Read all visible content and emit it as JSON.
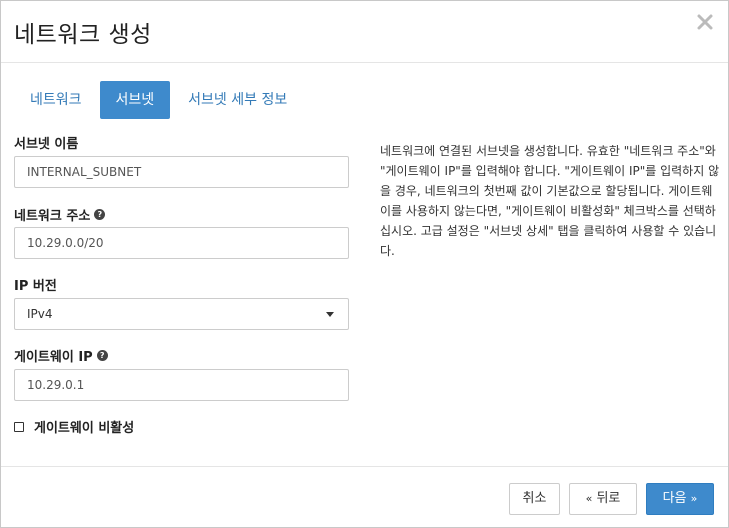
{
  "modal": {
    "title": "네트워크 생성"
  },
  "tabs": [
    {
      "label": "네트워크",
      "active": false
    },
    {
      "label": "서브넷",
      "active": true
    },
    {
      "label": "서브넷 세부 정보",
      "active": false
    }
  ],
  "form": {
    "subnet_name": {
      "label": "서브넷 이름",
      "value": "INTERNAL_SUBNET"
    },
    "network_address": {
      "label": "네트워크 주소",
      "value": "10.29.0.0/20"
    },
    "ip_version": {
      "label": "IP 버전",
      "value": "IPv4"
    },
    "gateway_ip": {
      "label": "게이트웨이 IP",
      "value": "10.29.0.1"
    },
    "disable_gateway": {
      "label": "게이트웨이 비활성",
      "checked": false
    }
  },
  "help_text": "네트워크에 연결된 서브넷을 생성합니다. 유효한 \"네트워크 주소\"와 \"게이트웨이 IP\"를 입력해야 합니다. \"게이트웨이 IP\"를 입력하지 않을 경우, 네트워크의 첫번째 값이 기본값으로 할당됩니다. 게이트웨이를 사용하지 않는다면, \"게이트웨이 비활성화\" 체크박스를 선택하십시오. 고급 설정은 \"서브넷 상세\" 탭을 클릭하여 사용할 수 있습니다.",
  "footer": {
    "cancel_label": "취소",
    "back_label": "뒤로",
    "back_chevron": "«",
    "next_label": "다음",
    "next_chevron": "»"
  },
  "colors": {
    "primary": "#3e8acc",
    "link": "#337ab7"
  }
}
